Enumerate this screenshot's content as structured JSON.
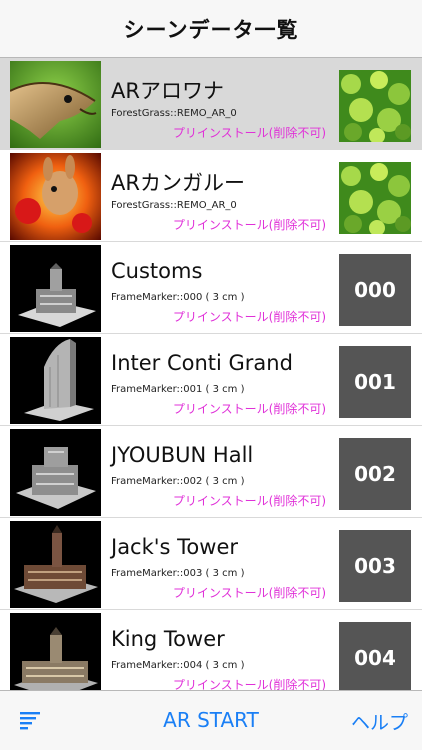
{
  "header": {
    "title": "シーンデータ一覧"
  },
  "rows": [
    {
      "title": "ARアロワナ",
      "subtitle": "ForestGrass::REMO_AR_0",
      "status": "プリインストール(削除不可)",
      "marker": "",
      "thumb_icon": "arowana-fish-icon"
    },
    {
      "title": "ARカンガルー",
      "subtitle": "ForestGrass::REMO_AR_0",
      "status": "プリインストール(削除不可)",
      "marker": "",
      "thumb_icon": "kangaroo-icon"
    },
    {
      "title": "Customs",
      "subtitle": "FrameMarker::000 ( 3 cm )",
      "status": "プリインストール(削除不可)",
      "marker": "000",
      "thumb_icon": "building-icon"
    },
    {
      "title": "Inter Conti Grand",
      "subtitle": "FrameMarker::001 ( 3 cm )",
      "status": "プリインストール(削除不可)",
      "marker": "001",
      "thumb_icon": "building-icon"
    },
    {
      "title": "JYOUBUN Hall",
      "subtitle": "FrameMarker::002 ( 3 cm )",
      "status": "プリインストール(削除不可)",
      "marker": "002",
      "thumb_icon": "building-icon"
    },
    {
      "title": "Jack's Tower",
      "subtitle": "FrameMarker::003 ( 3 cm )",
      "status": "プリインストール(削除不可)",
      "marker": "003",
      "thumb_icon": "building-icon"
    },
    {
      "title": "King Tower",
      "subtitle": "FrameMarker::004 ( 3 cm )",
      "status": "プリインストール(削除不可)",
      "marker": "004",
      "thumb_icon": "building-icon"
    }
  ],
  "toolbar": {
    "menu_icon": "list-menu-icon",
    "ar_start_label": "AR START",
    "help_label": "ヘルプ"
  },
  "colors": {
    "accent": "#1a7ff5",
    "status_text": "#e030d8",
    "marker_bg": "#555555",
    "selected_row": "#d9d9d9"
  }
}
